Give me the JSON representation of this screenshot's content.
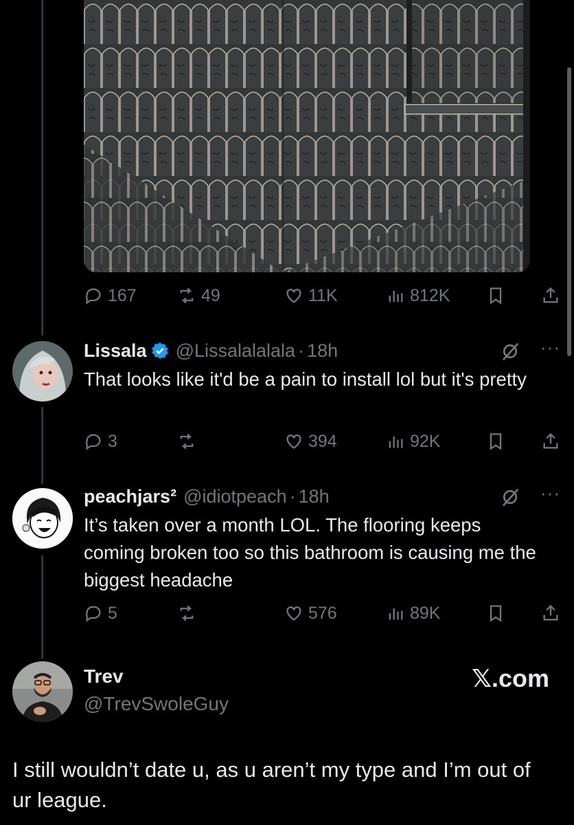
{
  "original_post": {
    "media_alt": "",
    "stats": {
      "replies": "167",
      "reposts": "49",
      "likes": "11K",
      "views": "812K"
    }
  },
  "replies": [
    {
      "name": "Lissala",
      "verified": true,
      "handle": "@Lissalalalala",
      "time": "18h",
      "text": "That looks like it'd be a pain to install lol but it's pretty",
      "stats": {
        "replies": "3",
        "reposts": "",
        "likes": "394",
        "views": "92K"
      }
    },
    {
      "name": "peachjars²",
      "verified": false,
      "handle": "@idiotpeach",
      "time": "18h",
      "text": "It’s taken over a month LOL. The flooring keeps coming broken too so this bathroom is causing me the biggest headache",
      "stats": {
        "replies": "5",
        "reposts": "",
        "likes": "576",
        "views": "89K"
      }
    }
  ],
  "quote_card": {
    "name": "Trev",
    "handle": "@TrevSwoleGuy",
    "brand": "𝕏.com",
    "text": "I still wouldn’t date u, as u aren’t my type and I’m out of ur league."
  },
  "colors": {
    "background": "#000000",
    "text": "#e7e9ea",
    "muted": "#71767b",
    "verified": "#1d9bf0",
    "thread_line": "#333639"
  },
  "icons": [
    "reply-icon",
    "repost-icon",
    "like-icon",
    "views-icon",
    "bookmark-icon",
    "share-icon",
    "grok-icon",
    "more-icon",
    "verified-badge-icon"
  ]
}
